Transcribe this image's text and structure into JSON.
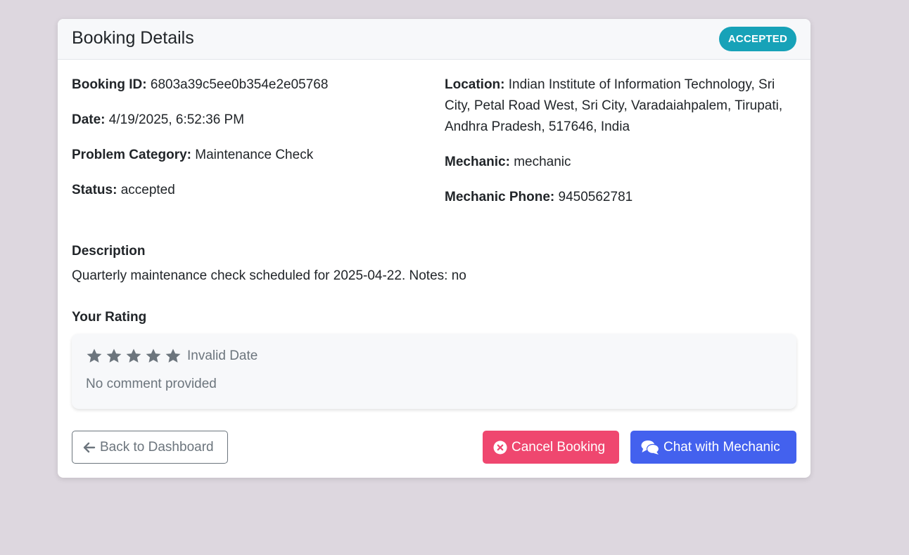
{
  "header": {
    "title": "Booking Details",
    "status_badge": "ACCEPTED"
  },
  "details_left": {
    "booking_id_label": "Booking ID:",
    "booking_id": "6803a39c5ee0b354e2e05768",
    "date_label": "Date:",
    "date": "4/19/2025, 6:52:36 PM",
    "category_label": "Problem Category:",
    "category": "Maintenance Check",
    "status_label": "Status:",
    "status": "accepted"
  },
  "details_right": {
    "location_label": "Location:",
    "location": "Indian Institute of Information Technology, Sri City, Petal Road West, Sri City, Varadaiahpalem, Tirupati, Andhra Pradesh, 517646, India",
    "mechanic_label": "Mechanic:",
    "mechanic": "mechanic",
    "phone_label": "Mechanic Phone:",
    "phone": "9450562781"
  },
  "description": {
    "heading": "Description",
    "text": "Quarterly maintenance check scheduled for 2025-04-22. Notes: no"
  },
  "rating": {
    "heading": "Your Rating",
    "stars_total": 5,
    "stars_filled": 5,
    "star_color": "#6c757d",
    "date": "Invalid Date",
    "comment": "No comment provided"
  },
  "actions": {
    "back_label": "Back to Dashboard",
    "cancel_label": "Cancel Booking",
    "chat_label": "Chat with Mechanic",
    "back_icon": "arrow-left-icon",
    "cancel_icon": "times-circle-icon",
    "chat_icon": "comments-icon"
  },
  "colors": {
    "badge": "#17a2b8",
    "cancel": "#ef476f",
    "chat": "#4361ee",
    "background": "#ddd7df"
  }
}
